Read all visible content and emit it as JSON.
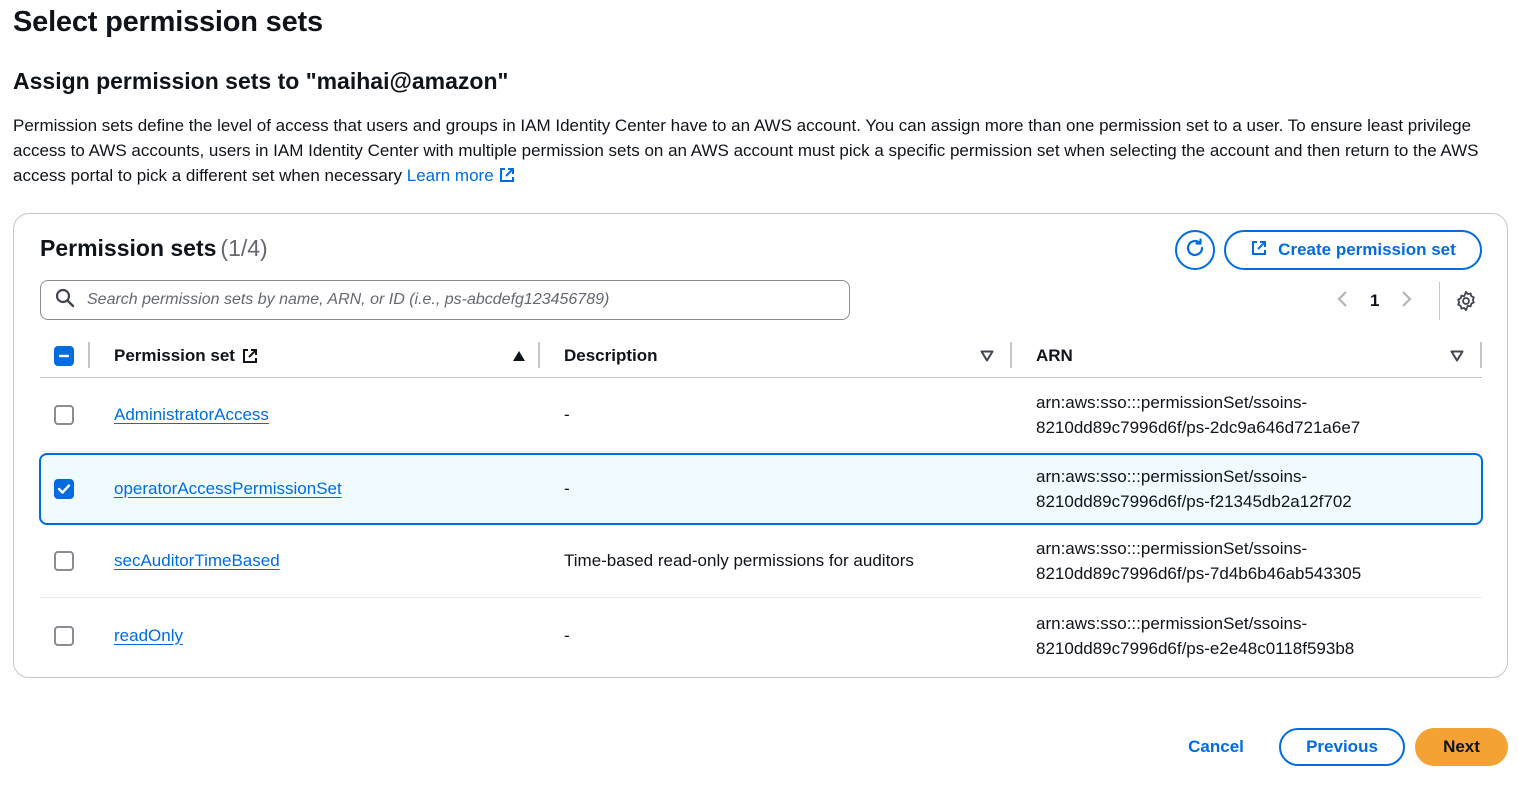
{
  "page": {
    "title": "Select permission sets",
    "section_title": "Assign permission sets to \"maihai@amazon\"",
    "description": "Permission sets define the level of access that users and groups in IAM Identity Center have to an AWS account. You can assign more than one permission set to a user. To ensure least privilege access to AWS accounts, users in IAM Identity Center with multiple permission sets on an AWS account must pick a specific permission set when selecting the account and then return to the AWS access portal to pick a different set when necessary",
    "learn_more": "Learn more"
  },
  "table": {
    "title": "Permission sets",
    "count": "(1/4)",
    "create_button": "Create permission set",
    "search_placeholder": "Search permission sets by name, ARN, or ID (i.e., ps-abcdefg123456789)",
    "page_number": "1",
    "columns": {
      "permission_set": "Permission set",
      "description": "Description",
      "arn": "ARN"
    },
    "rows": [
      {
        "name": "AdministratorAccess",
        "description": "-",
        "arn_line1": "arn:aws:sso:::permissionSet/ssoins-",
        "arn_line2": "8210dd89c7996d6f/ps-2dc9a646d721a6e7",
        "selected": false
      },
      {
        "name": "operatorAccessPermissionSet",
        "description": "-",
        "arn_line1": "arn:aws:sso:::permissionSet/ssoins-",
        "arn_line2": "8210dd89c7996d6f/ps-f21345db2a12f702",
        "selected": true
      },
      {
        "name": "secAuditorTimeBased",
        "description": "Time-based read-only permissions for auditors",
        "arn_line1": "arn:aws:sso:::permissionSet/ssoins-",
        "arn_line2": "8210dd89c7996d6f/ps-7d4b6b46ab543305",
        "selected": false
      },
      {
        "name": "readOnly",
        "description": "-",
        "arn_line1": "arn:aws:sso:::permissionSet/ssoins-",
        "arn_line2": "8210dd89c7996d6f/ps-e2e48c0118f593b8",
        "selected": false
      }
    ]
  },
  "footer": {
    "cancel": "Cancel",
    "previous": "Previous",
    "next": "Next"
  },
  "colors": {
    "accent": "#006ce0",
    "primary_button": "#f3a233",
    "selected_row_bg": "#f0fbff",
    "border": "#c6c6cd"
  },
  "icons": [
    "external-link-icon",
    "refresh-icon",
    "search-icon",
    "chevron-left-icon",
    "chevron-right-icon",
    "gear-icon",
    "sort-ascending-icon",
    "sort-icon",
    "checkmark-icon",
    "minus-icon"
  ]
}
